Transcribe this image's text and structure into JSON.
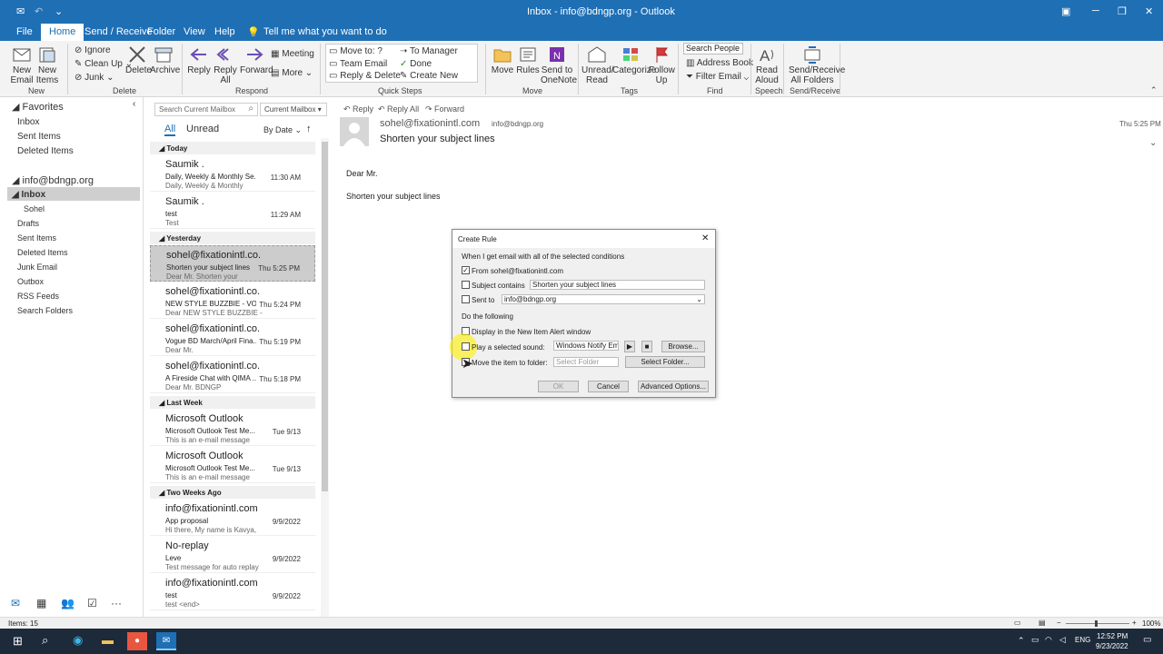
{
  "window": {
    "title": "Inbox - info@bdngp.org - Outlook",
    "tell_me": "Tell me what you want to do"
  },
  "tabs": [
    "File",
    "Home",
    "Send / Receive",
    "Folder",
    "View",
    "Help"
  ],
  "ribbon": {
    "new_email": "New\nEmail",
    "new_items": "New\nItems",
    "ignore": "Ignore",
    "clean_up": "Clean Up",
    "junk": "Junk",
    "delete": "Delete",
    "archive": "Archive",
    "reply": "Reply",
    "reply_all": "Reply\nAll",
    "forward": "Forward",
    "meeting": "Meeting",
    "more": "More",
    "move_to": "Move to: ?",
    "team_email": "Team Email",
    "reply_delete": "Reply & Delete",
    "to_manager": "To Manager",
    "done": "Done",
    "create_new": "Create New",
    "move": "Move",
    "rules": "Rules",
    "send_onenote": "Send to\nOneNote",
    "unread_read": "Unread/\nRead",
    "categorize": "Categorize",
    "follow_up": "Follow\nUp",
    "search_people": "Search People",
    "address_book": "Address Book",
    "filter_email": "Filter Email",
    "read_aloud": "Read\nAloud",
    "send_receive_all": "Send/Receive\nAll Folders",
    "groups": [
      "New",
      "Delete",
      "Respond",
      "Quick Steps",
      "Move",
      "Tags",
      "Find",
      "Speech",
      "Send/Receive"
    ]
  },
  "nav": {
    "favorites": "Favorites",
    "fav_items": [
      "Inbox",
      "Sent Items",
      "Deleted Items"
    ],
    "account": "info@bdngp.org",
    "folders": [
      "Inbox",
      "Sohel",
      "Drafts",
      "Sent Items",
      "Deleted Items",
      "Junk Email",
      "Outbox",
      "RSS Feeds",
      "Search Folders"
    ]
  },
  "list": {
    "search_placeholder": "Search Current Mailbox",
    "scope": "Current Mailbox",
    "all": "All",
    "unread": "Unread",
    "sort": "By Date",
    "groups": [
      {
        "name": "Today",
        "items": [
          {
            "from": "Saumik .",
            "subject": "Daily, Weekly & Monthly Se...",
            "preview": "Daily, Weekly & Monthly",
            "time": "11:30 AM"
          },
          {
            "from": "Saumik .",
            "subject": "test",
            "preview": "Test",
            "time": "11:29 AM"
          }
        ]
      },
      {
        "name": "Yesterday",
        "items": [
          {
            "from": "sohel@fixationintl.co...",
            "subject": "Shorten your subject lines",
            "preview": "Dear Mr.  Shorten your",
            "time": "Thu 5:25 PM"
          },
          {
            "from": "sohel@fixationintl.co...",
            "subject": "NEW STYLE BUZZBIE - VOB /...",
            "preview": "Dear  NEW STYLE BUZZBIE -",
            "time": "Thu 5:24 PM"
          },
          {
            "from": "sohel@fixationintl.co...",
            "subject": "Vogue BD March/April Fina...",
            "preview": "Dear Mr.",
            "time": "Thu 5:19 PM"
          },
          {
            "from": "sohel@fixationintl.co...",
            "subject": "A Fireside Chat with QIMA ...",
            "preview": "Dear Mr. BDNGP",
            "time": "Thu 5:18 PM"
          }
        ]
      },
      {
        "name": "Last Week",
        "items": [
          {
            "from": "Microsoft Outlook",
            "subject": "Microsoft Outlook Test Me...",
            "preview": "This is an e-mail message",
            "time": "Tue 9/13"
          },
          {
            "from": "Microsoft Outlook",
            "subject": "Microsoft Outlook Test Me...",
            "preview": "This is an e-mail message",
            "time": "Tue 9/13"
          }
        ]
      },
      {
        "name": "Two Weeks Ago",
        "items": [
          {
            "from": "info@fixationintl.com",
            "subject": "App proposal",
            "preview": "Hi there,  My name is Kavya,",
            "time": "9/9/2022"
          },
          {
            "from": "No-replay",
            "subject": "Leve",
            "preview": "Test message for auto replay",
            "time": "9/9/2022"
          },
          {
            "from": "info@fixationintl.com",
            "subject": "test",
            "preview": "test <end>",
            "time": "9/9/2022"
          }
        ]
      }
    ]
  },
  "reading": {
    "reply": "Reply",
    "reply_all": "Reply All",
    "forward": "Forward",
    "from": "sohel@fixationintl.com",
    "to": "info@bdngp.org",
    "subject": "Shorten your subject lines",
    "time": "Thu 5:25 PM",
    "body1": "Dear Mr.",
    "body2": "Shorten your subject lines"
  },
  "dialog": {
    "title": "Create Rule",
    "cond_header": "When I get email with all of the selected conditions",
    "from_label": "From sohel@fixationintl.com",
    "subject_label": "Subject contains",
    "subject_value": "Shorten your subject lines",
    "sent_label": "Sent to",
    "sent_value": "info@bdngp.org",
    "do_header": "Do the following",
    "display_label": "Display in the New Item Alert window",
    "play_label": "Play a selected sound:",
    "sound_value": "Windows Notify Em",
    "browse": "Browse...",
    "move_label": "Move the item to folder:",
    "folder_placeholder": "Select Folder",
    "select_folder": "Select Folder...",
    "ok": "OK",
    "cancel": "Cancel",
    "advanced": "Advanced Options..."
  },
  "status": {
    "items": "Items: 15",
    "zoom": "100%"
  },
  "taskbar": {
    "time": "12:52 PM",
    "date": "9/23/2022",
    "lang": "ENG"
  },
  "colors": {
    "brand": "#1f6fb5",
    "taskbar": "#1c2a3a"
  }
}
